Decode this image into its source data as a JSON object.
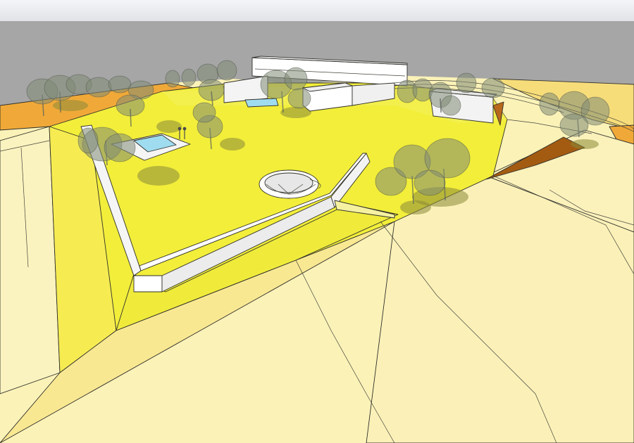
{
  "scene": {
    "view": "3d-site-model",
    "colors": {
      "sky_top": "#f2f3f6",
      "sky": "#a6a6a6",
      "lawn": "#f2ee3a",
      "lawn_light": "#f6f15e",
      "terrain": "#fbf2b8",
      "terrain_mid": "#f9e79b",
      "border_band": "#f2b23a",
      "orange_band": "#f0a938",
      "cut_wall": "#a35b12",
      "building": "#ffffff",
      "pool": "#9fdcf0",
      "tree": "#7f8a74",
      "tree_shadow": "#8b8a38"
    },
    "objects": [
      "main-house",
      "swimming-pool",
      "pool-deck",
      "circular-sunken-court",
      "retaining-wall",
      "tree-groups",
      "earth-cut",
      "human-figures"
    ]
  }
}
